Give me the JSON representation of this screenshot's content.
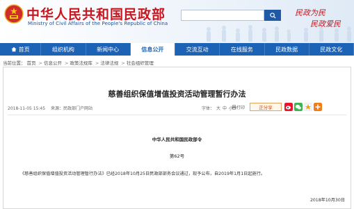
{
  "header": {
    "title": "中华人民共和国民政部",
    "subtitle": "Ministry of Civil Affairs of the People's Republic of China",
    "search_placeholder": "",
    "slogan_line1": "民政为民",
    "slogan_line2": "民政爱民",
    "brand_color": "#c8161e",
    "nav_color": "#1c63b5"
  },
  "nav": {
    "items": [
      {
        "label": "首页"
      },
      {
        "label": "组织机构"
      },
      {
        "label": "新闻中心"
      },
      {
        "label": "信息公开",
        "active": true
      },
      {
        "label": "交流互动"
      },
      {
        "label": "在线服务"
      },
      {
        "label": "民政数据"
      },
      {
        "label": "民政文化"
      }
    ]
  },
  "breadcrumb": {
    "prefix": "当前位置：",
    "items": [
      "首页",
      "信息公开",
      "政策法规库",
      "法律法规",
      "社会组织管理"
    ]
  },
  "article": {
    "title": "慈善组织保值增值投资活动管理暂行办法",
    "date": "2018-11-05 15:45",
    "source": "来源：民政部门户网站",
    "fontsize_label": "字体：",
    "fontsize_large": "大",
    "fontsize_medium": "中",
    "fontsize_small": "小",
    "print_label": "打印",
    "share_label": "正分享",
    "issuer": "中华人民共和国民政部令",
    "order_no": "第62号",
    "body": "《慈善组织保值增值投资活动管理暂行办法》已经2018年10月25日民政部部务会议通过，现予公布，自2019年1月1日起施行。",
    "sign_date": "2018年10月30日"
  },
  "icons": {
    "emblem": "national-emblem-icon",
    "search": "search-icon",
    "print": "print-icon",
    "weibo": "weibo-icon",
    "wechat": "wechat-icon",
    "qzone": "qzone-icon",
    "more": "plus-icon"
  }
}
